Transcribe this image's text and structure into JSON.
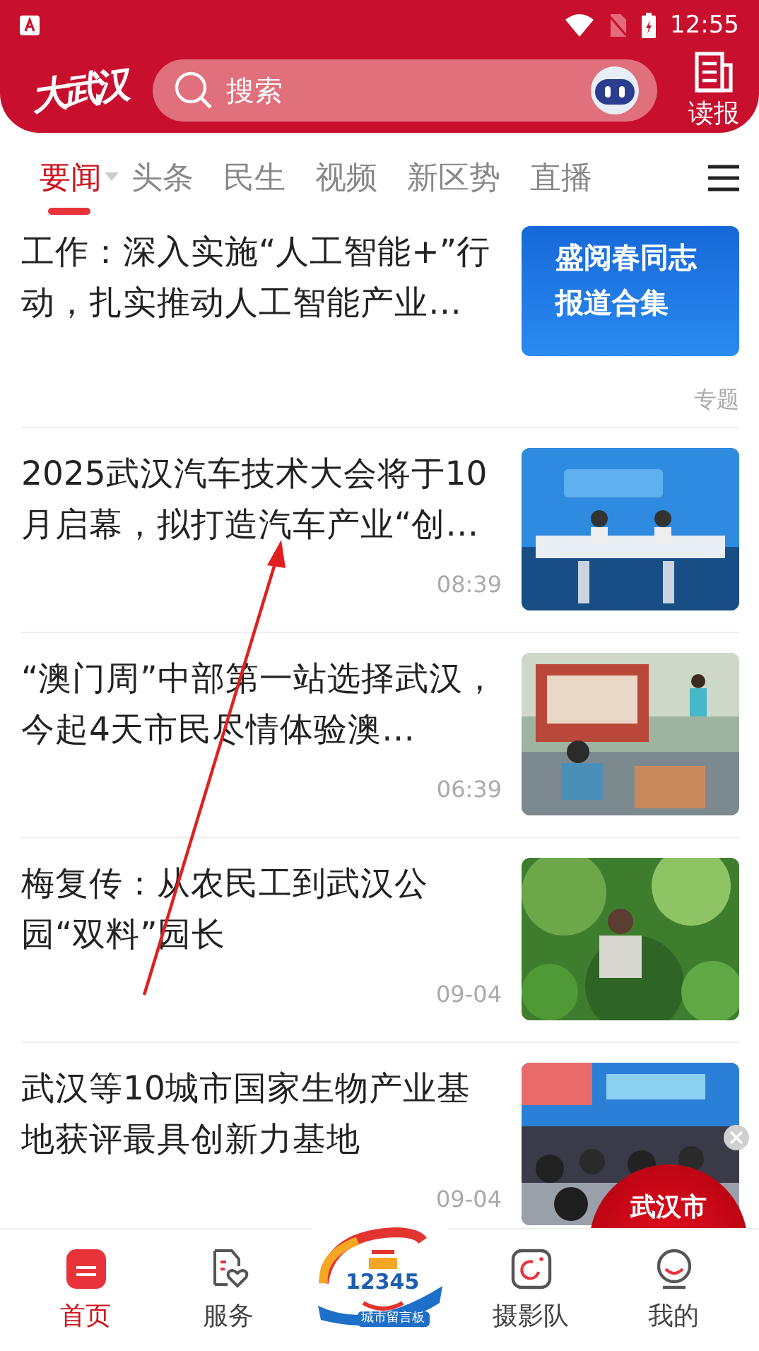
{
  "status_bar": {
    "time": "12:55"
  },
  "header": {
    "logo": "大武汉",
    "search_placeholder": "搜索",
    "read_button": "读报"
  },
  "tabs": [
    {
      "label": "要闻",
      "selected": true,
      "dropdown": true
    },
    {
      "label": "头条",
      "selected": false
    },
    {
      "label": "民生",
      "selected": false
    },
    {
      "label": "视频",
      "selected": false
    },
    {
      "label": "新区势",
      "selected": false
    },
    {
      "label": "直播",
      "selected": false
    }
  ],
  "articles": [
    {
      "title": "工作：深入实施“人工智能+”行动，扎实推动人工智能产业…",
      "thumb": {
        "kind": "banner",
        "text": "盛阅春同志报道合集"
      },
      "meta": "专题"
    },
    {
      "title": "2025武汉汽车技术大会将于10月启幕，拟打造汽车产业“创…",
      "meta": "08:39"
    },
    {
      "title": "“澳门周”中部第一站选择武汉，今起4天市民尽情体验澳…",
      "meta": "06:39"
    },
    {
      "title": "梅复传：从农民工到武汉公园“双料”园长",
      "meta": "09-04"
    },
    {
      "title": "武汉等10城市国家生物产业基地获评最具创新力基地",
      "meta": "09-04"
    }
  ],
  "floating_ad": {
    "text": "武汉市"
  },
  "bottom_nav": [
    {
      "kind": "home",
      "label": "首页",
      "selected": true
    },
    {
      "kind": "service",
      "label": "服务",
      "selected": false
    },
    {
      "kind": "logo",
      "number": "12345",
      "caption": "城市留言板"
    },
    {
      "kind": "camera",
      "label": "摄影队",
      "selected": false
    },
    {
      "kind": "profile",
      "label": "我的",
      "selected": false
    }
  ]
}
